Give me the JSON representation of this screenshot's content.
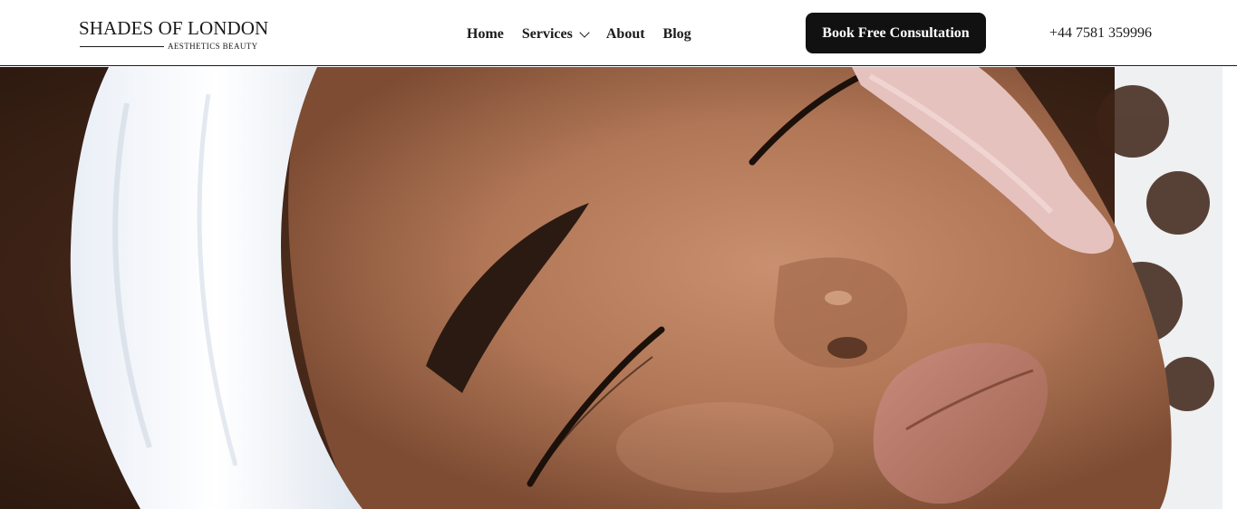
{
  "brand": {
    "title": "SHADES OF LONDON",
    "subtitle": "AESTHETICS BEAUTY"
  },
  "nav": {
    "items": [
      {
        "label": "Home"
      },
      {
        "label": "Services",
        "icon": "chevron-down-icon"
      },
      {
        "label": "About"
      },
      {
        "label": "Blog"
      }
    ]
  },
  "cta": {
    "label": "Book Free Consultation"
  },
  "contact": {
    "phone": "+44 7581 359996"
  },
  "colors": {
    "text": "#1a1a1a",
    "button_bg": "#111111",
    "button_text": "#ffffff",
    "background": "#ffffff"
  }
}
